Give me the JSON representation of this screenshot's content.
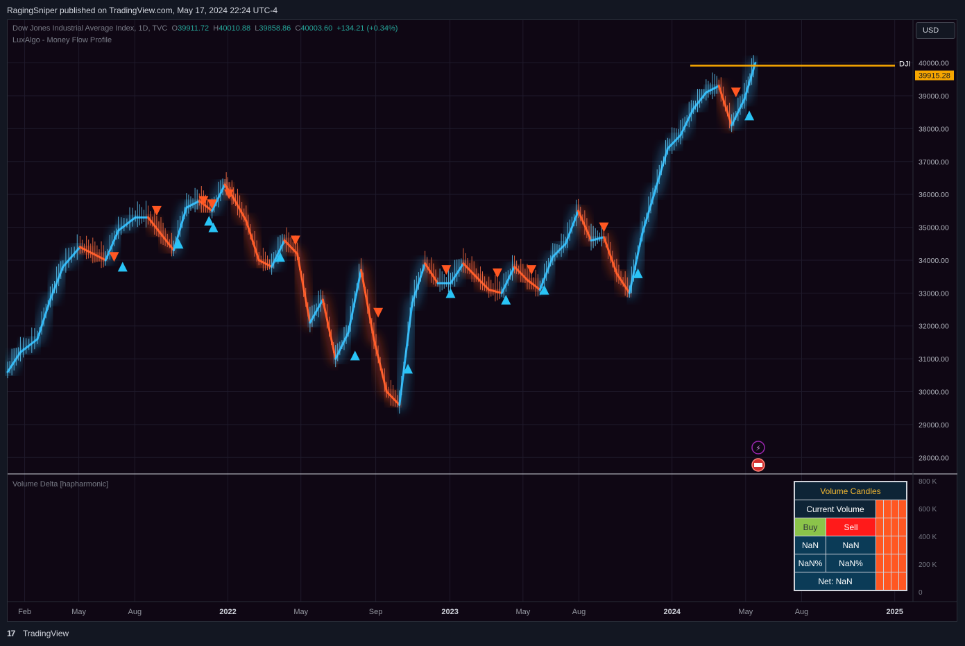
{
  "header": {
    "published": "RagingSniper published on TradingView.com, May 17, 2024 22:24 UTC-4"
  },
  "legend": {
    "symbol": "Dow Jones Industrial Average Index, 1D, TVC",
    "o_label": "O",
    "o_value": "39911.72",
    "h_label": "H",
    "h_value": "40010.88",
    "l_label": "L",
    "l_value": "39858.86",
    "c_label": "C",
    "c_value": "40003.60",
    "change": "+134.21 (+0.34%)",
    "indicator": "LuxAlgo - Money Flow Profile",
    "volume_indicator": "Volume Delta [hapharmonic]"
  },
  "currency": "USD",
  "footer": {
    "brand": "TradingView",
    "logo": "17"
  },
  "price_tag": {
    "symbol": "DJI",
    "price": "39915.28",
    "price_value": 39915.28,
    "color": "#f7a600"
  },
  "volume_table": {
    "title": "Volume Candles",
    "current": "Current Volume",
    "buy": "Buy",
    "sell": "Sell",
    "buy_val": "NaN",
    "sell_val": "NaN",
    "buy_pct": "NaN%",
    "sell_pct": "NaN%",
    "net": "Net: NaN"
  },
  "colors": {
    "bull": "#29b6f6",
    "bear": "#ff5722",
    "price_line": "#f7a600",
    "background": "#0f0714"
  },
  "icons": [
    "lightning-icon",
    "us-flag-icon"
  ],
  "chart_data": {
    "type": "line",
    "x_axis_labels": [
      "Feb",
      "May",
      "Aug",
      "2022",
      "May",
      "Sep",
      "2023",
      "May",
      "Aug",
      "2024",
      "May",
      "Aug",
      "2025"
    ],
    "y_axis_labels": [
      "40000.00",
      "39000.00",
      "38000.00",
      "37000.00",
      "36000.00",
      "35000.00",
      "34000.00",
      "33000.00",
      "32000.00",
      "31000.00",
      "30000.00",
      "29000.00",
      "28000.00"
    ],
    "ylim": [
      27500,
      41300
    ],
    "volume_axis_labels": [
      "800 K",
      "600 K",
      "400 K",
      "200 K",
      "0"
    ],
    "x_range": [
      "2021-01-04",
      "2025-01-31"
    ],
    "series": [
      {
        "x": [
          "2021-01-04",
          "2021-01-25",
          "2021-02-22",
          "2021-03-15",
          "2021-04-05",
          "2021-05-03",
          "2021-05-24",
          "2021-06-14",
          "2021-07-05",
          "2021-08-02",
          "2021-08-23",
          "2021-09-13",
          "2021-10-04",
          "2021-10-25",
          "2021-11-15",
          "2021-12-06",
          "2021-12-27",
          "2022-01-10",
          "2022-01-31",
          "2022-02-21",
          "2022-03-14",
          "2022-04-04",
          "2022-04-25",
          "2022-05-16",
          "2022-06-06",
          "2022-06-27",
          "2022-07-18",
          "2022-08-08",
          "2022-08-29",
          "2022-09-19",
          "2022-10-10",
          "2022-10-31",
          "2022-11-21",
          "2022-12-12",
          "2023-01-02",
          "2023-01-23",
          "2023-02-13",
          "2023-03-06",
          "2023-03-27",
          "2023-04-17",
          "2023-05-08",
          "2023-05-29",
          "2023-06-19",
          "2023-07-10",
          "2023-07-31",
          "2023-08-21",
          "2023-09-11",
          "2023-10-02",
          "2023-10-23",
          "2023-11-13",
          "2023-12-04",
          "2023-12-25",
          "2024-01-15",
          "2024-02-05",
          "2024-02-26",
          "2024-03-18",
          "2024-04-08",
          "2024-04-29",
          "2024-05-17"
        ],
        "y": [
          30600,
          31200,
          31600,
          32800,
          33800,
          34400,
          34200,
          34000,
          34900,
          35300,
          35300,
          34800,
          34300,
          35600,
          35800,
          35500,
          36300,
          35900,
          35200,
          34000,
          33800,
          34600,
          34200,
          32100,
          32800,
          31000,
          31800,
          33700,
          31600,
          30000,
          29600,
          32700,
          33900,
          33300,
          33300,
          33900,
          33500,
          33100,
          33000,
          33800,
          33400,
          33100,
          34100,
          34500,
          35500,
          34600,
          34700,
          33600,
          33000,
          34800,
          36100,
          37400,
          37800,
          38600,
          39100,
          39300,
          38100,
          38900,
          40000
        ]
      }
    ],
    "markers": {
      "up": [
        [
          "2021-07-12",
          33800
        ],
        [
          "2021-10-12",
          34500
        ],
        [
          "2021-12-01",
          35200
        ],
        [
          "2021-12-08",
          35000
        ],
        [
          "2022-03-28",
          34100
        ],
        [
          "2022-07-29",
          31100
        ],
        [
          "2022-10-24",
          30700
        ],
        [
          "2023-01-02",
          33000
        ],
        [
          "2023-04-03",
          32800
        ],
        [
          "2023-06-05",
          33100
        ],
        [
          "2023-11-06",
          33600
        ],
        [
          "2024-05-07",
          38400
        ]
      ],
      "down": [
        [
          "2021-06-28",
          34100
        ],
        [
          "2021-09-06",
          35500
        ],
        [
          "2021-11-22",
          35800
        ],
        [
          "2021-12-06",
          35700
        ],
        [
          "2022-01-03",
          36000
        ],
        [
          "2022-04-22",
          34600
        ],
        [
          "2022-09-05",
          32400
        ],
        [
          "2022-12-26",
          33700
        ],
        [
          "2023-03-20",
          33600
        ],
        [
          "2023-05-15",
          33700
        ],
        [
          "2023-09-11",
          35000
        ],
        [
          "2024-04-15",
          39100
        ]
      ]
    }
  }
}
